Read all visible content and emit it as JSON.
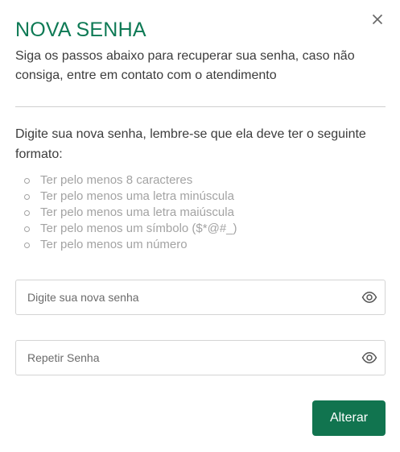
{
  "modal": {
    "title": "NOVA SENHA",
    "subtitle": "Siga os passos abaixo para recuperar sua senha, caso não consiga, entre em contato com o atendimento",
    "close_icon": "close-icon"
  },
  "instructions": {
    "text": "Digite sua nova senha, lembre-se que ela deve ter o seguinte formato:",
    "requirements": [
      "Ter pelo menos 8 caracteres",
      "Ter pelo menos uma letra minúscula",
      "Ter pelo menos uma letra maiúscula",
      "Ter pelo menos um símbolo ($*@#_)",
      "Ter pelo menos um número"
    ]
  },
  "form": {
    "new_password": {
      "placeholder": "Digite sua nova senha",
      "value": "",
      "icon": "eye-icon"
    },
    "repeat_password": {
      "placeholder": "Repetir Senha",
      "value": "",
      "icon": "eye-icon"
    },
    "submit_label": "Alterar"
  },
  "colors": {
    "accent": "#0e7a55",
    "button": "#11744f",
    "muted_text": "#a3a3a3",
    "border": "#d4d4d4"
  }
}
